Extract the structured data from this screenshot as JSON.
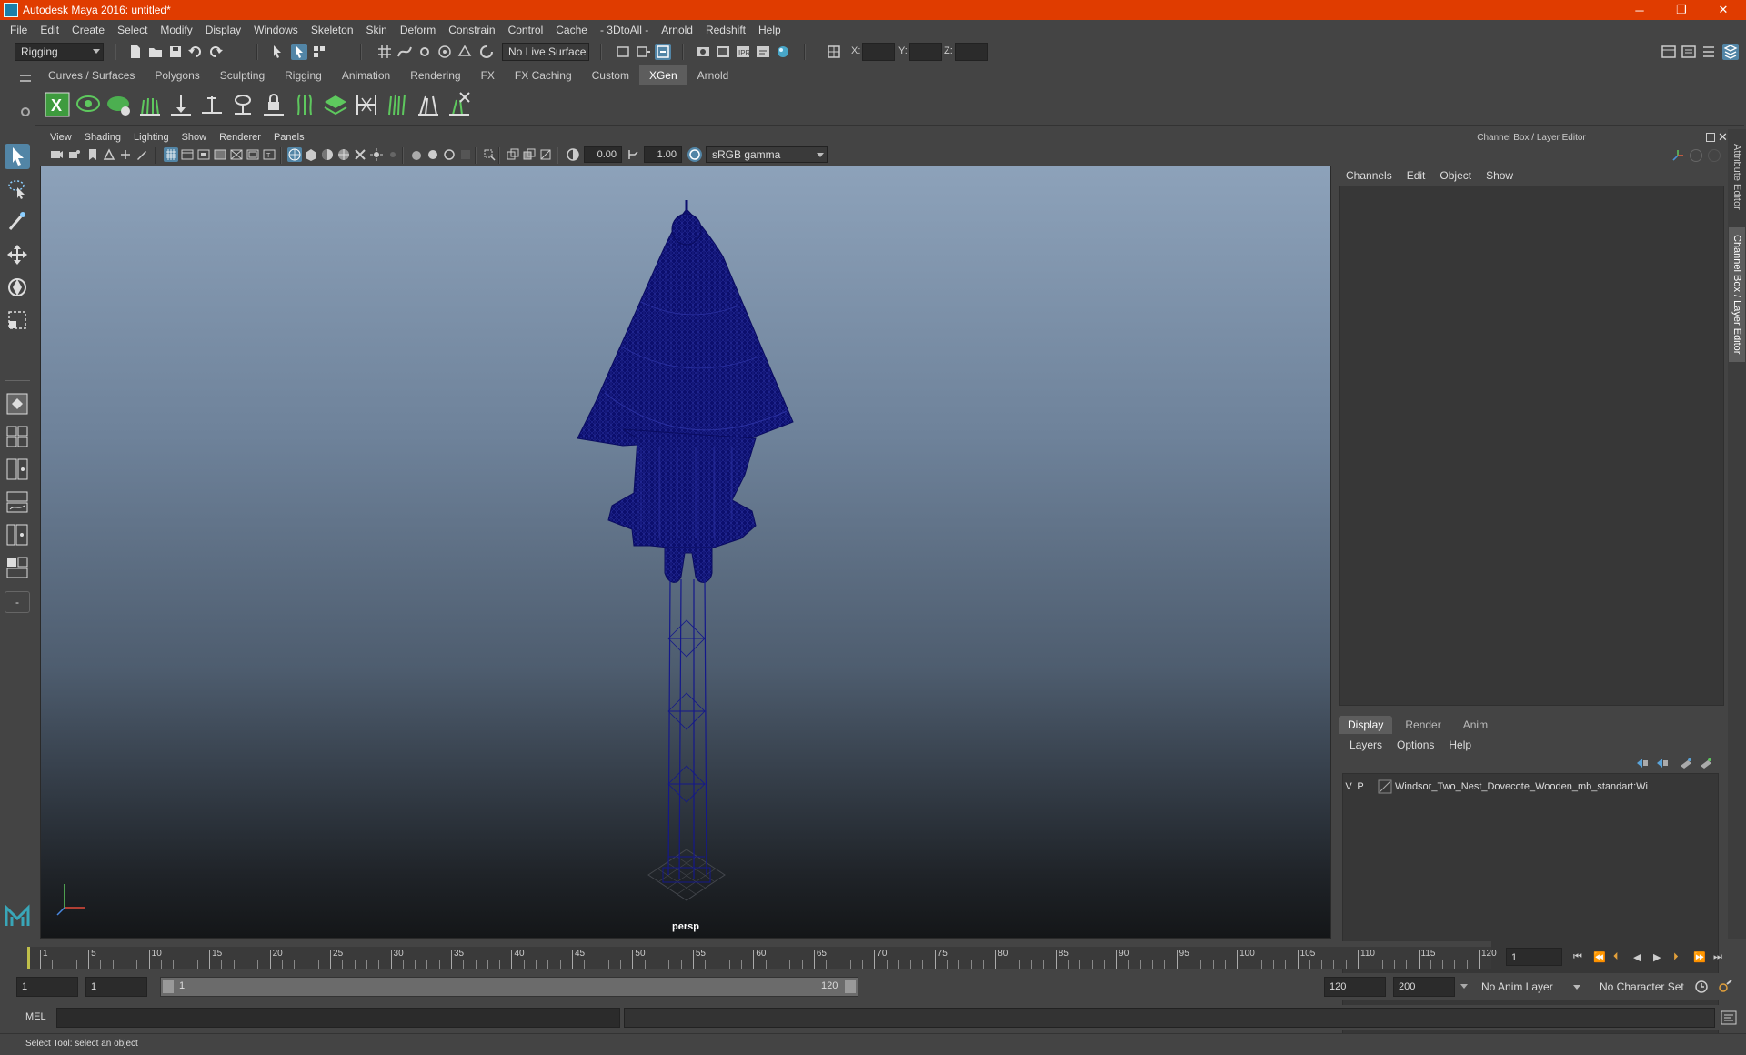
{
  "window": {
    "title": "Autodesk Maya 2016: untitled*",
    "controls": {
      "minimize": "─",
      "maximize": "❐",
      "close": "✕"
    }
  },
  "menubar": [
    "File",
    "Edit",
    "Create",
    "Select",
    "Modify",
    "Display",
    "Windows",
    "Skeleton",
    "Skin",
    "Deform",
    "Constrain",
    "Control",
    "Cache",
    "- 3DtoAll -",
    "Arnold",
    "Redshift",
    "Help"
  ],
  "statusline": {
    "menuset": "Rigging",
    "live_surface": "No Live Surface",
    "x_label": "X:",
    "y_label": "Y:",
    "z_label": "Z:"
  },
  "shelf": {
    "tabs": [
      "Curves / Surfaces",
      "Polygons",
      "Sculpting",
      "Rigging",
      "Animation",
      "Rendering",
      "FX",
      "FX Caching",
      "Custom",
      "XGen",
      "Arnold"
    ],
    "active_tab": "XGen"
  },
  "viewport": {
    "menus": [
      "View",
      "Shading",
      "Lighting",
      "Show",
      "Renderer",
      "Panels"
    ],
    "exposure": "0.00",
    "gamma": "1.00",
    "color_space": "sRGB gamma",
    "camera_label": "persp"
  },
  "channel_box": {
    "title": "Channel Box / Layer Editor",
    "menus": [
      "Channels",
      "Edit",
      "Object",
      "Show"
    ]
  },
  "layer_editor": {
    "tabs": [
      "Display",
      "Render",
      "Anim"
    ],
    "active_tab": "Display",
    "menus": [
      "Layers",
      "Options",
      "Help"
    ],
    "layers": [
      {
        "v": "V",
        "p": "P",
        "name": "Windsor_Two_Nest_Dovecote_Wooden_mb_standart:Wi"
      }
    ]
  },
  "side_tabs": [
    "Attribute Editor",
    "Channel Box / Layer Editor"
  ],
  "timeline": {
    "ticks": [
      "1",
      "5",
      "10",
      "15",
      "20",
      "25",
      "30",
      "35",
      "40",
      "45",
      "50",
      "55",
      "60",
      "65",
      "70",
      "75",
      "80",
      "85",
      "90",
      "95",
      "100",
      "105",
      "110",
      "115",
      "120"
    ],
    "current_frame": "1"
  },
  "range": {
    "start": "1",
    "playback_start": "1",
    "slider_start": "1",
    "slider_end": "120",
    "playback_end": "120",
    "end": "200",
    "anim_layer": "No Anim Layer",
    "character_set": "No Character Set"
  },
  "command_line": {
    "label": "MEL"
  },
  "help_line": {
    "text": "Select Tool: select an object"
  }
}
